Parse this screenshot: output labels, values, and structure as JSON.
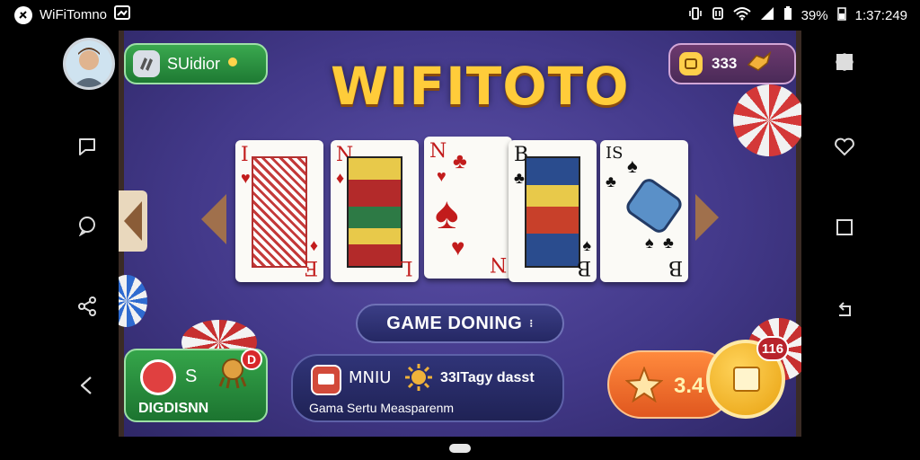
{
  "statusbar": {
    "app_title": "WiFiTomno",
    "battery": "39%",
    "clock": "1:37:249"
  },
  "game": {
    "logo_text": "WIFITOTO",
    "solitaire_label": "SUidior",
    "coin_value": "333",
    "cards": [
      {
        "top": "I",
        "bottom": "E",
        "color": "red"
      },
      {
        "top": "N",
        "bottom": "L",
        "color": "red"
      },
      {
        "top": "N",
        "bottom": "N",
        "color": "red"
      },
      {
        "top": "B",
        "bottom": "B",
        "color": "black"
      },
      {
        "top": "IS",
        "bottom": "B",
        "color": "black"
      }
    ],
    "status_button": "GAME DONING",
    "bottom_left": {
      "mini": "S",
      "label": "DIGDISNN",
      "badge": "D"
    },
    "bottom_mid": {
      "title": "MNIU",
      "extra": "33ITagy dasst",
      "sub": "Gama Sertu Measparenm"
    },
    "bottom_right": {
      "count": "3.4",
      "badge": "116"
    }
  },
  "colors": {
    "felt": "#43398a",
    "green_pill": "#2b8f40",
    "gold": "#ffcc3a",
    "orange": "#ff8a3d"
  },
  "icons": {
    "left_sidebar": [
      "message-icon",
      "chat-icon",
      "share-icon",
      "back-icon"
    ],
    "right_sidebar": [
      "puzzle-icon",
      "heart-icon",
      "square-icon",
      "undo-icon"
    ]
  }
}
